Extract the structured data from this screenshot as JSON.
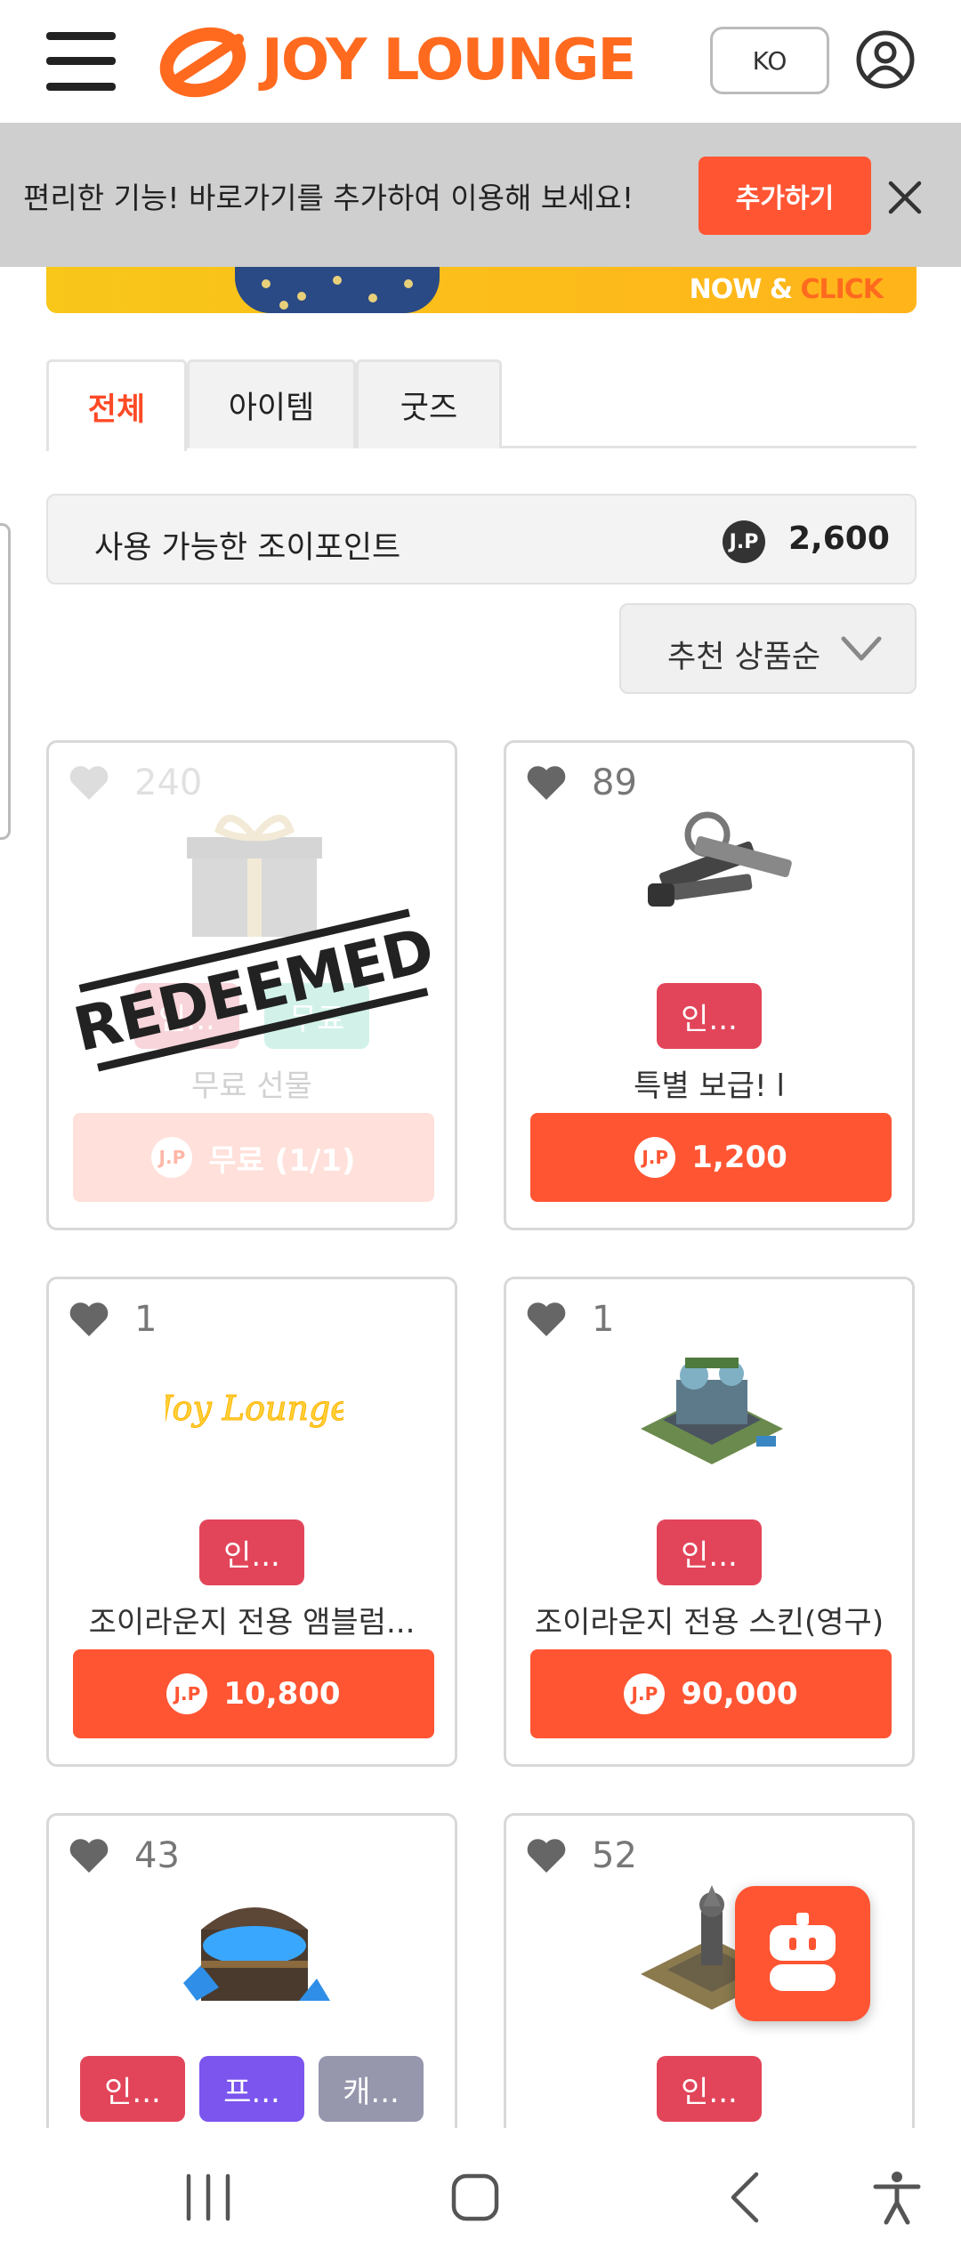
{
  "header": {
    "logo_text": "JOY LOUNGE",
    "lang_label": "KO",
    "icons": [
      "menu-icon",
      "user-icon"
    ]
  },
  "shortcut_banner": {
    "text": "편리한 기능! 바로가기를 추가하여 이용해 보세요!",
    "add_label": "추가하기",
    "close_icon": "close-icon"
  },
  "promo_banner": {
    "text_now": "NOW & ",
    "text_click": "CLICK"
  },
  "tabs": [
    {
      "label": "전체",
      "active": true
    },
    {
      "label": "아이템",
      "active": false
    },
    {
      "label": "굿즈",
      "active": false
    }
  ],
  "points": {
    "label": "사용 가능한 조이포인트",
    "currency": "J.P",
    "value": "2,600"
  },
  "sort": {
    "label": "추천 상품순"
  },
  "products": [
    {
      "likes": "240",
      "tags": [
        "인...",
        "무료"
      ],
      "name": "무료 선물",
      "price_label": "무료 (1/1)",
      "currency": "J.P",
      "stamp": "REDEEMED",
      "image": "gift-box"
    },
    {
      "likes": "89",
      "tags": [
        "인..."
      ],
      "name": "특별 보급! l",
      "price_label": "1,200",
      "currency": "J.P",
      "image": "keys"
    },
    {
      "likes": "1",
      "tags": [
        "인..."
      ],
      "name": "조이라운지 전용 앰블럼...",
      "price_label": "10,800",
      "currency": "J.P",
      "image": "neon-emblem",
      "emblem_text": "Joy Lounge"
    },
    {
      "likes": "1",
      "tags": [
        "인..."
      ],
      "name": "조이라운지 전용 스킨(영구)",
      "price_label": "90,000",
      "currency": "J.P",
      "image": "building-skin"
    },
    {
      "likes": "43",
      "tags": [
        "인...",
        "프...",
        "캐..."
      ],
      "image": "treasure-chest"
    },
    {
      "likes": "52",
      "tags": [
        "인..."
      ],
      "image": "statue"
    }
  ],
  "colors": {
    "accent": "#ff5533",
    "brand_orange": "#ff6a1f",
    "tag_red": "#e2455a",
    "tag_purple": "#7b55ee",
    "tag_gray": "#9696ad"
  },
  "navbar": {
    "icons": [
      "recent-apps-icon",
      "home-icon",
      "back-icon",
      "accessibility-icon"
    ]
  }
}
